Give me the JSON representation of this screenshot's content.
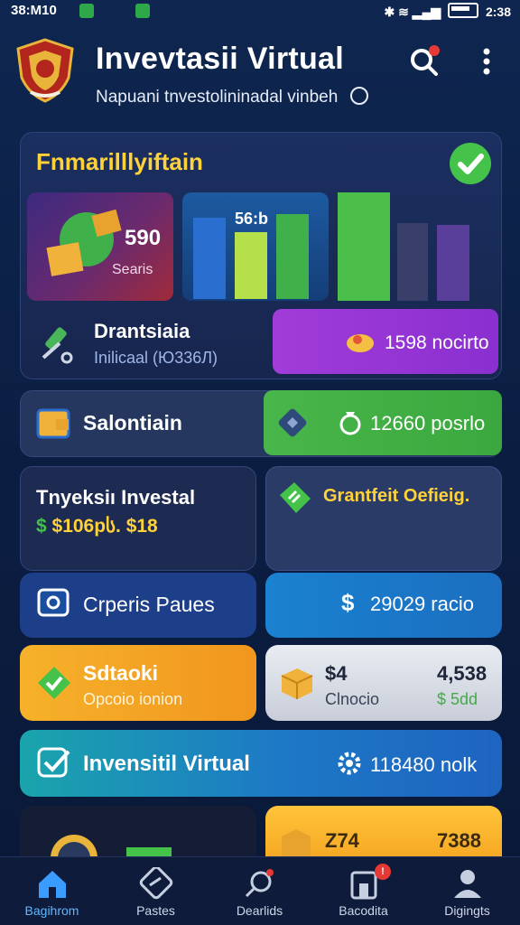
{
  "status_bar": {
    "time": "38:M10",
    "right_time": "2:38"
  },
  "header": {
    "title": "Invevtasii Virtual",
    "subtitle": "Napuani tnvestolininadal vinbeh"
  },
  "summary": {
    "title": "Fnmarilllyiftain",
    "tile_value": "590",
    "tile_label": "Searis",
    "bars_label": "56:b"
  },
  "rows": {
    "drantsiaia_title": "Drantsiaia",
    "drantsiaia_sub": "Inilicaal (Ю336Л)",
    "purple_value": "1598 nocirto",
    "salontiain_label": "Salontiain",
    "green_value": "12660 posrlo",
    "inveksi_title": "Tnyeksiı Investal",
    "inveksi_value": "$106pს. $18",
    "grantfeit_title": "Grantfeit Oefieig.",
    "cpreris_label": "Crperis Paues",
    "blue_value": "29029 racio",
    "blue_dollar": "$",
    "sdtaoki_title": "Sdtaoki",
    "sdtaoki_sub": "Opcoio ionion",
    "gray_a": "$4",
    "gray_b": "4,538",
    "gray_c": "Clnocio",
    "gray_d": "$ 5dd",
    "teal_label": "Invensitil Virtual",
    "teal_value": "118480 nolk",
    "bottom_a": "Z74",
    "bottom_b": "7388"
  },
  "nav": [
    {
      "label": "Bagihrom",
      "active": true
    },
    {
      "label": "Pastes",
      "active": false
    },
    {
      "label": "Dearlids",
      "active": false
    },
    {
      "label": "Bacodita",
      "active": false,
      "badge": "!"
    },
    {
      "label": "Digingts",
      "active": false
    }
  ],
  "colors": {
    "accent_yellow": "#ffd23a",
    "green": "#45c24a",
    "purple": "#9a36d6",
    "blue": "#1a82d0",
    "orange": "#f6b12a",
    "nav_active": "#5eb8ff"
  }
}
